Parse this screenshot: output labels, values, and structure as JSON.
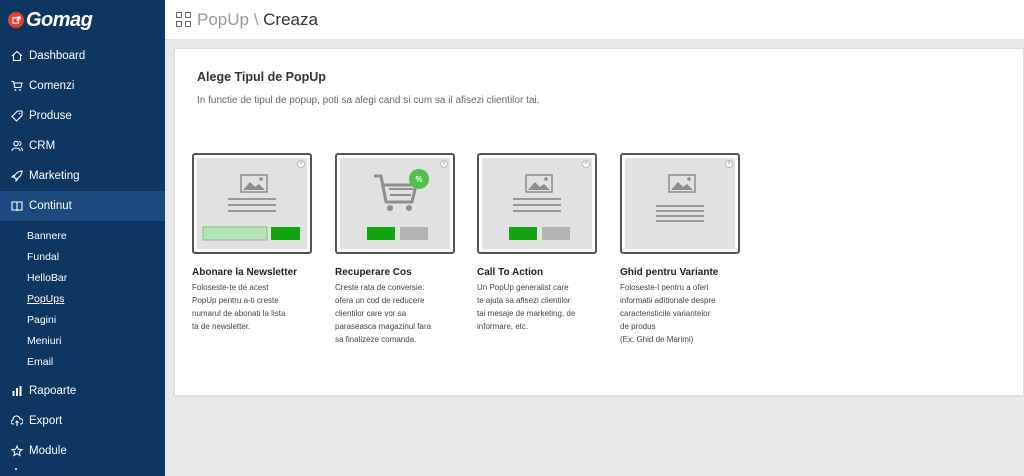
{
  "app": {
    "logo_text": "Gomag"
  },
  "sidebar": {
    "items": [
      {
        "label": "Dashboard",
        "icon": "home-icon"
      },
      {
        "label": "Comenzi",
        "icon": "cart-icon"
      },
      {
        "label": "Produse",
        "icon": "tag-icon"
      },
      {
        "label": "CRM",
        "icon": "users-icon"
      },
      {
        "label": "Marketing",
        "icon": "rocket-icon"
      },
      {
        "label": "Continut",
        "icon": "book-icon"
      }
    ],
    "sub_items": [
      "Bannere",
      "Fundal",
      "HelloBar",
      "PopUps",
      "Pagini",
      "Meniuri",
      "Email"
    ],
    "items_after": [
      {
        "label": "Rapoarte",
        "icon": "chart-icon"
      },
      {
        "label": "Export",
        "icon": "export-icon"
      },
      {
        "label": "Module",
        "icon": "star-icon"
      }
    ]
  },
  "header": {
    "crumb": "PopUp \\ ",
    "title": "Creaza"
  },
  "main": {
    "heading": "Alege Tipul de PopUp",
    "subtitle": "In functie de tipul de popup, poti sa alegi cand si cum sa il afisezi clientilor tai.",
    "cards": [
      {
        "title": "Abonare la Newsletter",
        "desc": [
          "Foloseste-te de acest",
          "PopUp pentru a-ti creste",
          "numarul de abonati la lista",
          "ta de newsletter."
        ]
      },
      {
        "title": "Recuperare Cos",
        "desc": [
          "Creste rata de conversie:",
          "ofera un cod de reducere",
          "clientilor care vor sa",
          "paraseasca magazinul fara",
          "sa finalizeze comanda."
        ],
        "badge": "%"
      },
      {
        "title": "Call To Action",
        "desc": [
          "Un PopUp generalist care",
          "te ajuta sa afisezi clientilor",
          "tai mesaje de marketing, de",
          "informare, etc."
        ]
      },
      {
        "title": "Ghid pentru Variante",
        "desc": [
          "Foloseste-l pentru a oferi",
          "informatii aditionale despre",
          "caracteristicile variantelor",
          "de produs",
          "(Ex: Ghid de Marimi)"
        ]
      }
    ]
  },
  "colors": {
    "sidebar": "#0f3561",
    "sidebar_active": "#1d4a7d",
    "green": "#11a311",
    "light_green": "#b5e3b5"
  }
}
